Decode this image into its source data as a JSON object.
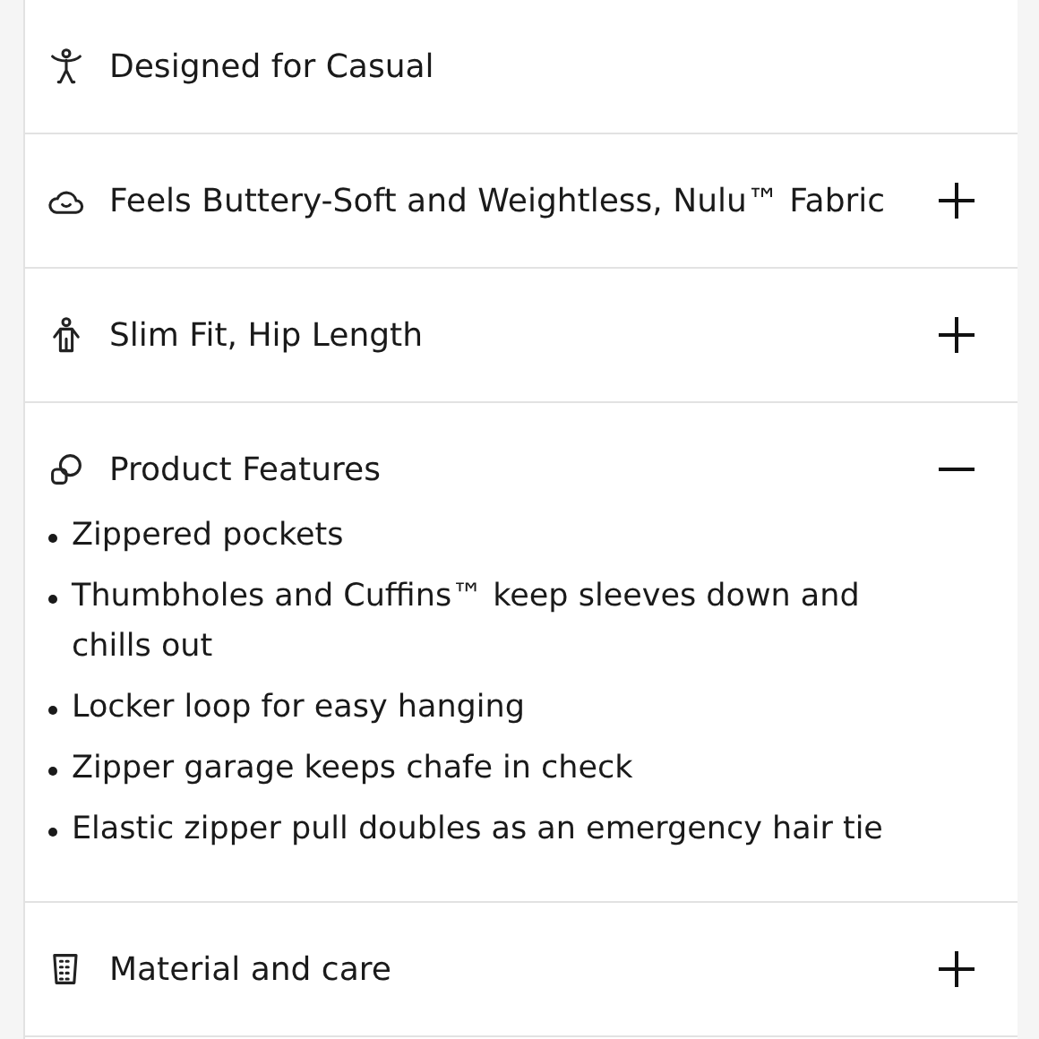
{
  "sections": [
    {
      "title": "Designed for Casual",
      "kind": "static"
    },
    {
      "title": "Feels Buttery-Soft and Weightless, Nulu™ Fabric",
      "kind": "toggle",
      "expanded": false
    },
    {
      "title": "Slim Fit, Hip Length",
      "kind": "toggle",
      "expanded": false
    },
    {
      "title": "Product Features",
      "kind": "toggle",
      "expanded": true,
      "items": [
        "Zippered pockets",
        "Thumbholes and Cuffins™ keep sleeves down and chills out",
        "Locker loop for easy hanging",
        "Zipper garage keeps chafe in check",
        "Elastic zipper pull doubles as an emergency hair tie"
      ]
    },
    {
      "title": "Material and care",
      "kind": "toggle",
      "expanded": false
    }
  ]
}
